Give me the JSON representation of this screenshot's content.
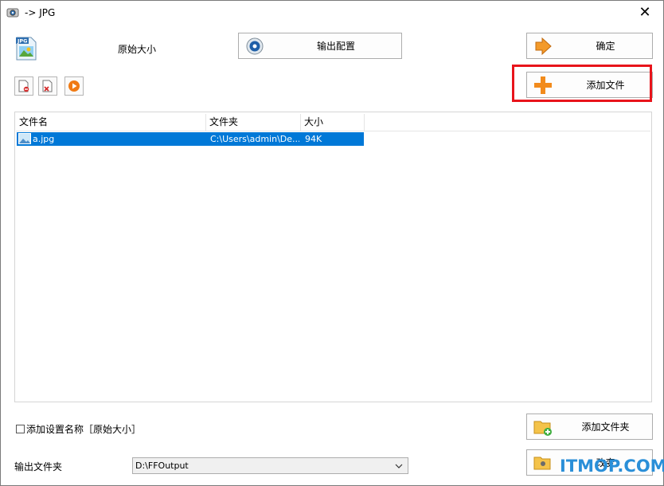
{
  "window": {
    "title": "-> JPG",
    "close_glyph": "✕"
  },
  "header": {
    "format_icon": "jpg-file-icon",
    "format_badge": "JPG",
    "size_label": "原始大小",
    "output_config_label": "输出配置",
    "ok_label": "确定",
    "add_file_label": "添加文件"
  },
  "toolbar": {
    "items": [
      {
        "name": "remove-icon"
      },
      {
        "name": "clear-list-icon"
      },
      {
        "name": "play-icon"
      }
    ]
  },
  "file_list": {
    "columns": [
      "文件名",
      "文件夹",
      "大小"
    ],
    "rows": [
      {
        "name": "a.jpg",
        "folder": "C:\\Users\\admin\\De...",
        "size": "94K"
      }
    ]
  },
  "footer": {
    "add_setting_name_label": "添加设置名称［原始大小］",
    "add_folder_label": "添加文件夹",
    "output_folder_label": "输出文件夹",
    "output_folder_value": "D:\\FFOutput",
    "change_label": "改变",
    "watermark": "ITMOP.COM"
  },
  "colors": {
    "selection": "#0078d7",
    "highlight": "#e8141b",
    "watermark": "#2a8fd8"
  }
}
